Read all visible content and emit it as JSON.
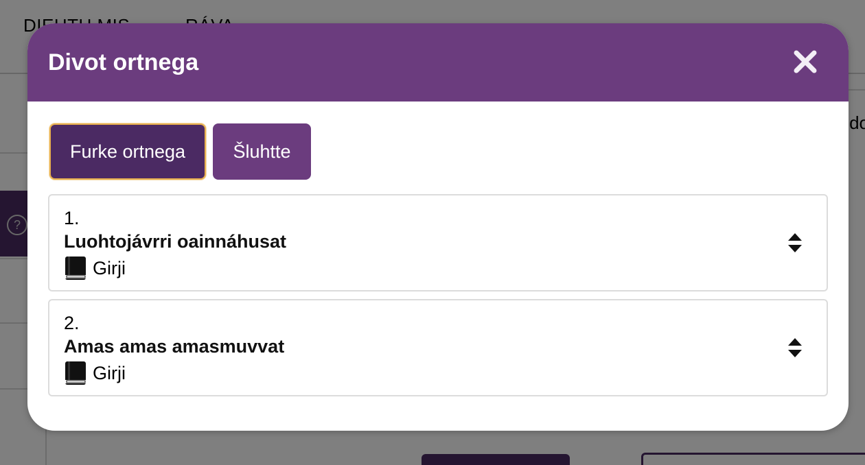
{
  "background": {
    "nav_items": [
      "DIEHTU MIS",
      "RÁVA"
    ],
    "band_text": "do"
  },
  "modal": {
    "title": "Divot ortnega",
    "close_icon": "close-icon",
    "buttons": {
      "sort_label": "Furke ortnega",
      "close_label": "Šluhtte"
    },
    "items": [
      {
        "number": "1.",
        "title": "Luohtojávrri oainnáhusat",
        "type_icon": "book-icon",
        "type_label": "Girji"
      },
      {
        "number": "2.",
        "title": "Amas amas amasmuvvat",
        "type_icon": "book-icon",
        "type_label": "Girji"
      }
    ]
  },
  "colors": {
    "header": "#6b3c7e",
    "button_dark": "#4b2a63",
    "focus_ring": "#e8b04f"
  }
}
